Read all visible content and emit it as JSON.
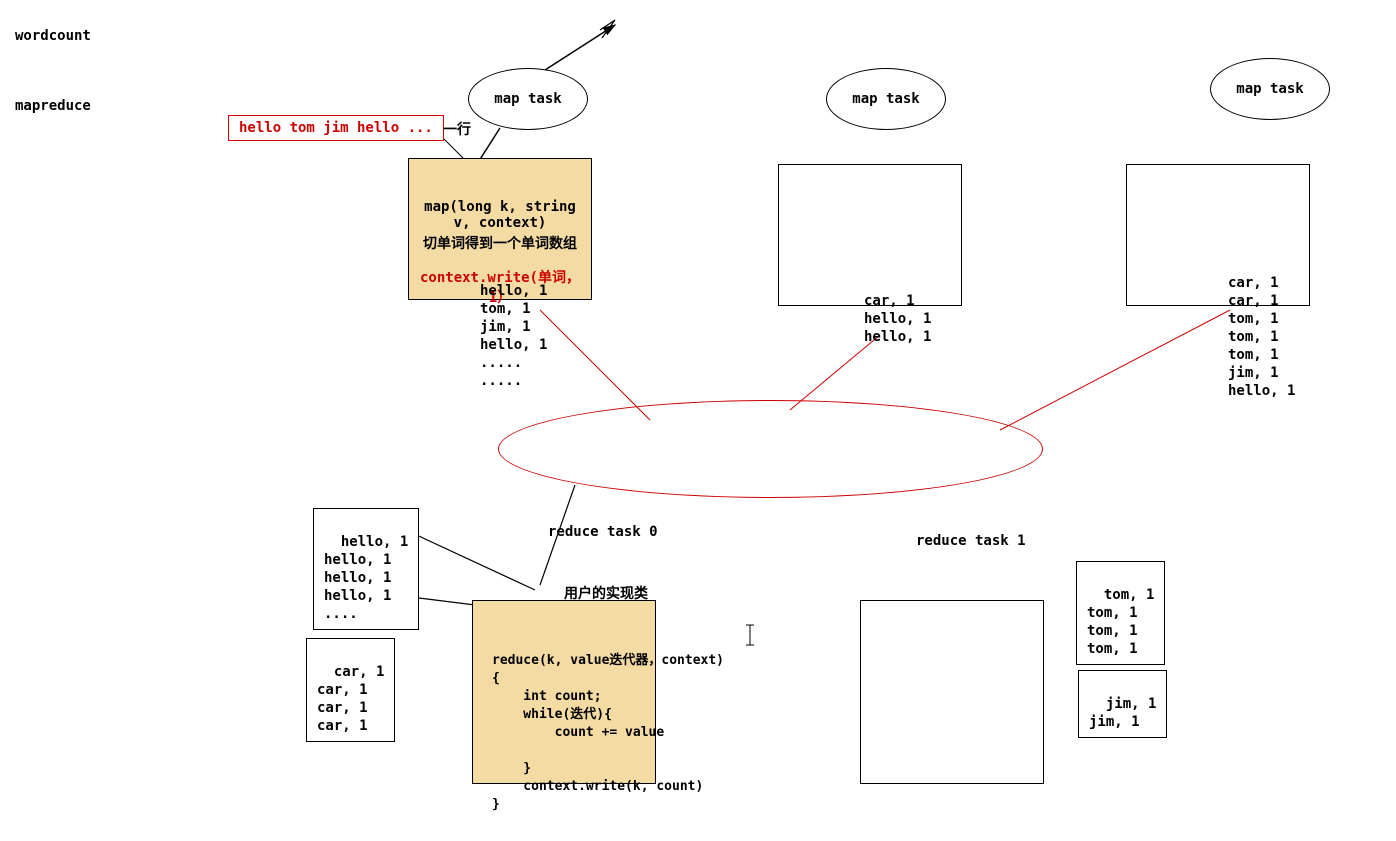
{
  "header": {
    "title1": "wordcount",
    "title2": "mapreduce"
  },
  "input_box": {
    "text": "hello tom jim hello ...",
    "label_right": "一行"
  },
  "map_tasks": {
    "label": "map task"
  },
  "map_box1": {
    "func_sig": "map(long k, string v, context)",
    "desc": "切单词得到一个单词数组",
    "write": "context.write(单词，1）",
    "outputs": "hello, 1\ntom, 1\njim, 1\nhello, 1\n.....\n....."
  },
  "map_box2": {
    "outputs": "car, 1\nhello, 1\nhello, 1"
  },
  "map_box3": {
    "outputs": "car, 1\ncar, 1\ntom, 1\ntom, 1\ntom, 1\njim, 1\nhello, 1"
  },
  "reduce": {
    "task0": "reduce task 0",
    "task1": "reduce task 1",
    "user_class": "用户的实现类"
  },
  "group_hello": "hello, 1\nhello, 1\nhello, 1\nhello, 1\n....",
  "group_car": "car, 1\ncar, 1\ncar, 1\ncar, 1",
  "group_tom": "tom, 1\ntom, 1\ntom, 1\ntom, 1",
  "group_jim": "jim, 1\njim, 1",
  "reduce_code": "reduce(k, value迭代器，context)\n{\n    int count;\n    while(迭代){\n        count += value\n\n    }\n    context.write(k, count)\n}"
}
